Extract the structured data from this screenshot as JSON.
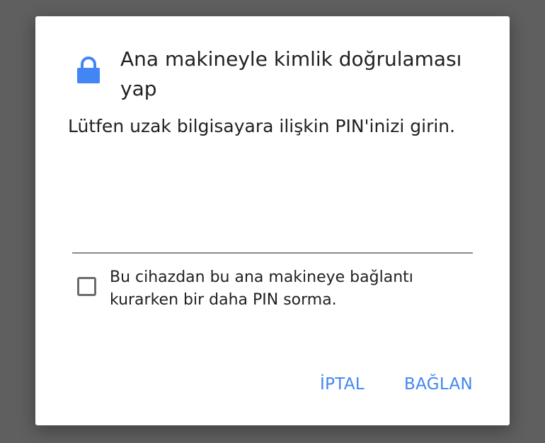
{
  "dialog": {
    "icon": "lock-icon",
    "title": "Ana makineyle kimlik doğrulaması yap",
    "message": "Lütfen uzak bilgisayara ilişkin PIN'inizi girin.",
    "pin_value": "",
    "checkbox": {
      "checked": false,
      "label": "Bu cihazdan bu ana makineye bağlantı kurarken bir daha PIN sorma."
    },
    "buttons": {
      "cancel_label": "İPTAL",
      "connect_label": "BAĞLAN"
    }
  },
  "colors": {
    "accent": "#4285f4",
    "backdrop": "#5f5f5f",
    "text": "#212121"
  }
}
